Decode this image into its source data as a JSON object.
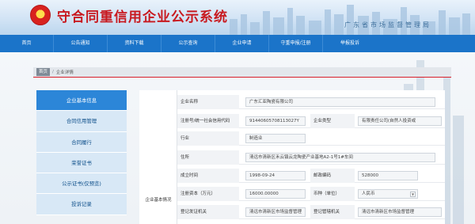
{
  "header": {
    "title": "守合同重信用企业公示系统",
    "subtitle": "广东省市场监督管理局"
  },
  "nav": [
    "首页",
    "公告通知",
    "资料下载",
    "公示查询",
    "企业申请",
    "守重申报/注册",
    "举报投诉"
  ],
  "breadcrumb": {
    "home": "首页",
    "current": "企业详情"
  },
  "sidebar": [
    "企业基本信息",
    "合同信用管理",
    "合同履行",
    "荣誉证书",
    "公示证书(仅预览)",
    "投诉记录"
  ],
  "content": {
    "group_label": "企业基本情况",
    "fields": {
      "name_label": "企业名称",
      "name_value": "广东汇亚陶瓷有限公司",
      "reg_label": "注册号/统一社会信用代码",
      "reg_value": "91440605708113027Y",
      "type_label": "企业类型",
      "type_value": "有限责任公司(自然人投资或",
      "industry_label": "行业",
      "industry_value": "制造业",
      "address_label": "住所",
      "address_value": "清远市清新区禾云镇云龙陶瓷产业基地A2-1号1#车间",
      "founded_label": "成立时间",
      "founded_value": "1998-09-24",
      "postcode_label": "邮政编码",
      "postcode_value": "528000",
      "capital_label": "注册资本（万元）",
      "capital_value": "16000.00000",
      "currency_label": "币种（单位）",
      "currency_value": "人民币",
      "issuer_label": "登记发证机关",
      "issuer_value": "清远市清新区市场监督管理",
      "manager_label": "登记管辖机关",
      "manager_value": "清远市清新区市场监督管理"
    }
  },
  "colors": {
    "nav": "#1b74c9",
    "title": "#c8191f",
    "sidebar_active": "#2c86d8",
    "sidebar": "#d8e8f6"
  }
}
